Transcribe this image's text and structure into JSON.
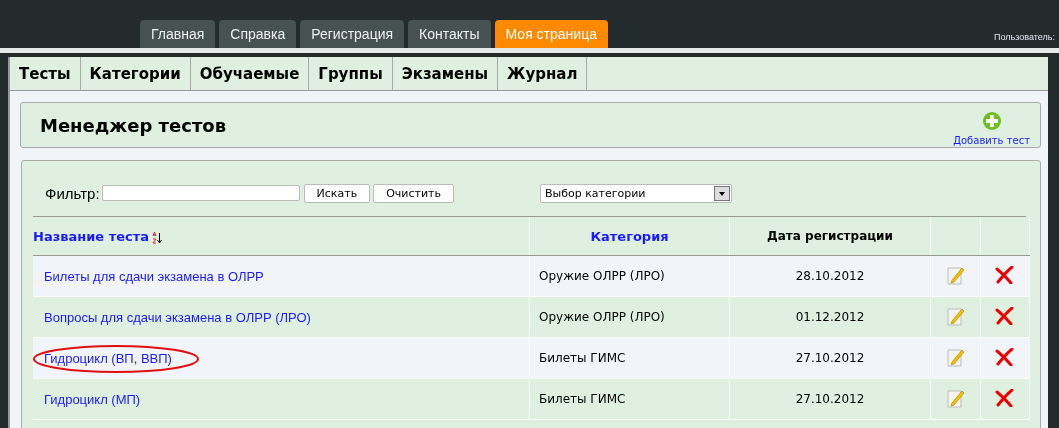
{
  "top_menu": [
    {
      "label": "Главная",
      "selected": false
    },
    {
      "label": "Справка",
      "selected": false
    },
    {
      "label": "Регистрация",
      "selected": false
    },
    {
      "label": "Контакты",
      "selected": false
    },
    {
      "label": "Моя страница",
      "selected": true
    }
  ],
  "user_label": "Пользователь:",
  "sub_menu": [
    "Тесты",
    "Категории",
    "Обучаемые",
    "Группы",
    "Экзамены",
    "Журнал"
  ],
  "page_title": "Менеджер тестов",
  "add_button": "Добавить тест",
  "filter": {
    "label": "Фильтр:",
    "search_button": "Искать",
    "clear_button": "Очистить",
    "category_select": "Выбор категории"
  },
  "table": {
    "columns": [
      {
        "label": "Название теста",
        "kind": "sortlink"
      },
      {
        "label": "Категория",
        "kind": "link"
      },
      {
        "label": "Дата регистрации",
        "kind": "plain"
      }
    ],
    "rows": [
      {
        "name": "Билеты для сдачи экзамена в ОЛРР",
        "category": "Оружие ОЛРР (ЛРО)",
        "date": "28.10.2012",
        "circled": false
      },
      {
        "name": "Вопросы для сдачи экзамена в ОЛРР (ЛРО)",
        "category": "Оружие ОЛРР (ЛРО)",
        "date": "01.12.2012",
        "circled": false
      },
      {
        "name": "Гидроцикл (ВП, ВВП)",
        "category": "Билеты ГИМС",
        "date": "27.10.2012",
        "circled": true
      },
      {
        "name": "Гидроцикл (МП)",
        "category": "Билеты ГИМС",
        "date": "27.10.2012",
        "circled": false
      }
    ]
  }
}
